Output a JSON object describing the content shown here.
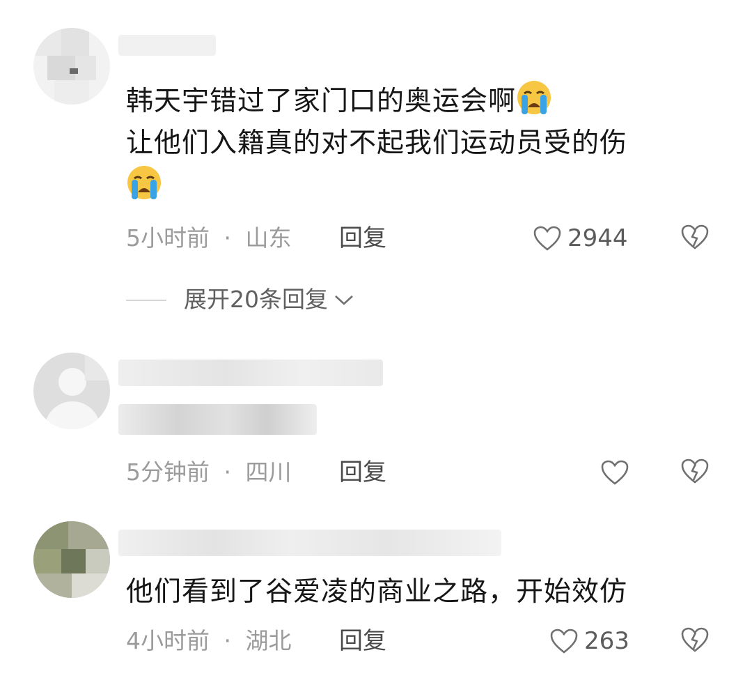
{
  "comments": [
    {
      "text_lines": [
        "韩天宇错过了家门口的奥运会啊",
        "让他们入籍真的对不起我们运动员受的伤"
      ],
      "emoji": "loudly-crying-face",
      "time": "5小时前",
      "separator": "·",
      "location": "山东",
      "reply_label": "回复",
      "likes": "2944",
      "expand_label": "展开20条回复"
    },
    {
      "time": "5分钟前",
      "separator": "·",
      "location": "四川",
      "reply_label": "回复",
      "likes": ""
    },
    {
      "text": "他们看到了谷爱凌的商业之路，开始效仿",
      "time": "4小时前",
      "separator": "·",
      "location": "湖北",
      "reply_label": "回复",
      "likes": "263"
    }
  ],
  "icons": {
    "like": "heart-outline-icon",
    "dislike": "broken-heart-icon",
    "expand": "chevron-down-icon"
  },
  "colors": {
    "text": "#161616",
    "meta": "#9b9b9b",
    "reply": "#4a4a4a",
    "icon": "#6f6f6f",
    "emoji_face": "#f7c642",
    "emoji_tears": "#3aa3e6"
  }
}
